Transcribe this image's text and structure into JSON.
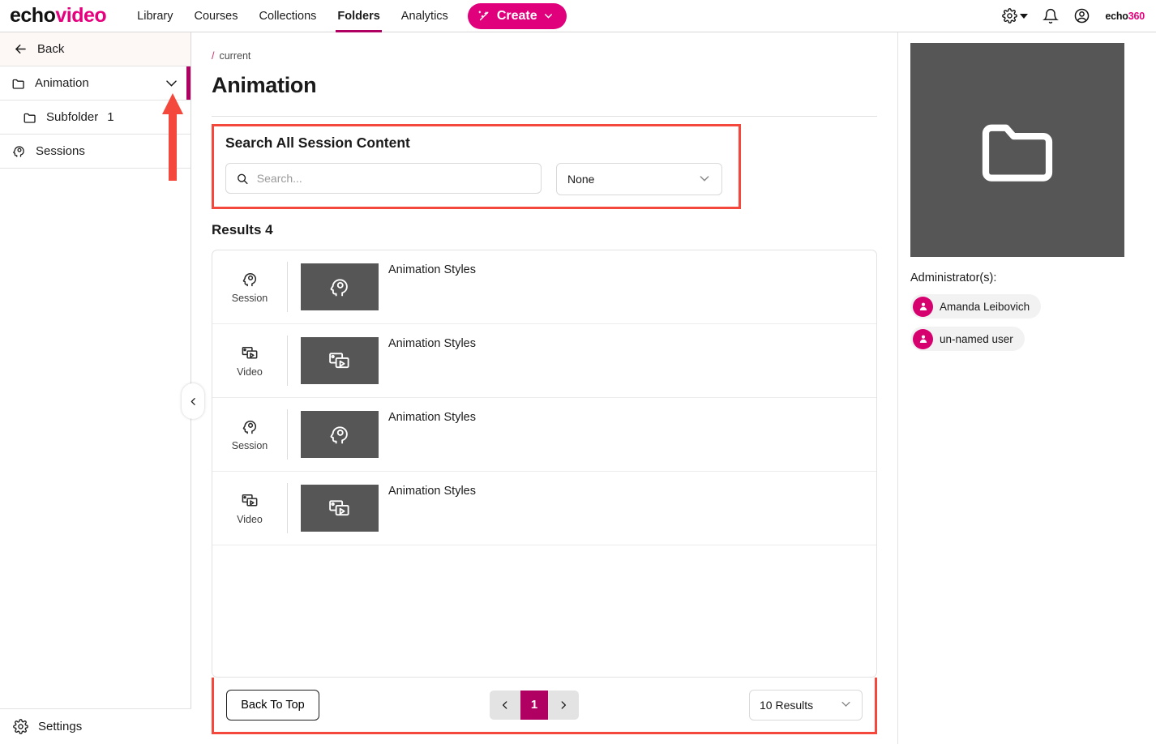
{
  "brand": {
    "logo_echo": "echo",
    "logo_video": "video",
    "corner_logo_1": "echo",
    "corner_logo_2": "360",
    "accent_magenta": "#B00061",
    "accent_pink": "#E0007B",
    "annotation_red": "#F4483C"
  },
  "nav": {
    "links": [
      {
        "label": "Library",
        "active": false
      },
      {
        "label": "Courses",
        "active": false
      },
      {
        "label": "Collections",
        "active": false
      },
      {
        "label": "Folders",
        "active": true
      },
      {
        "label": "Analytics",
        "active": false
      }
    ],
    "create_label": "Create",
    "icons": [
      "gear-icon",
      "bell-icon",
      "account-icon"
    ]
  },
  "sidebar": {
    "back_label": "Back",
    "items": [
      {
        "label": "Animation",
        "icon": "folder-icon",
        "selected": true,
        "expandable": true
      },
      {
        "label": "Subfolder",
        "count": "1",
        "icon": "folder-icon",
        "indent": true
      },
      {
        "label": "Sessions",
        "icon": "session-head-icon"
      }
    ],
    "settings_label": "Settings"
  },
  "main": {
    "breadcrumb_slash": "/",
    "breadcrumb_current": "current",
    "page_title": "Animation",
    "search": {
      "heading": "Search All Session Content",
      "placeholder": "Search...",
      "value": "",
      "filter_value": "None"
    },
    "results_heading": "Results 4",
    "rows": [
      {
        "type": "Session",
        "icon": "session-head-icon",
        "title": "Animation Styles"
      },
      {
        "type": "Video",
        "icon": "video-media-icon",
        "title": "Animation Styles"
      },
      {
        "type": "Session",
        "icon": "session-head-icon",
        "title": "Animation Styles"
      },
      {
        "type": "Video",
        "icon": "video-media-icon",
        "title": "Animation Styles"
      }
    ],
    "pager": {
      "back_to_top": "Back To Top",
      "current_page": "1",
      "page_size": "10 Results"
    }
  },
  "rightpanel": {
    "thumbnail_icon": "folder-icon",
    "admins_label": "Administrator(s):",
    "admins": [
      {
        "name": "Amanda Leibovich"
      },
      {
        "name": "un-named user"
      }
    ]
  }
}
